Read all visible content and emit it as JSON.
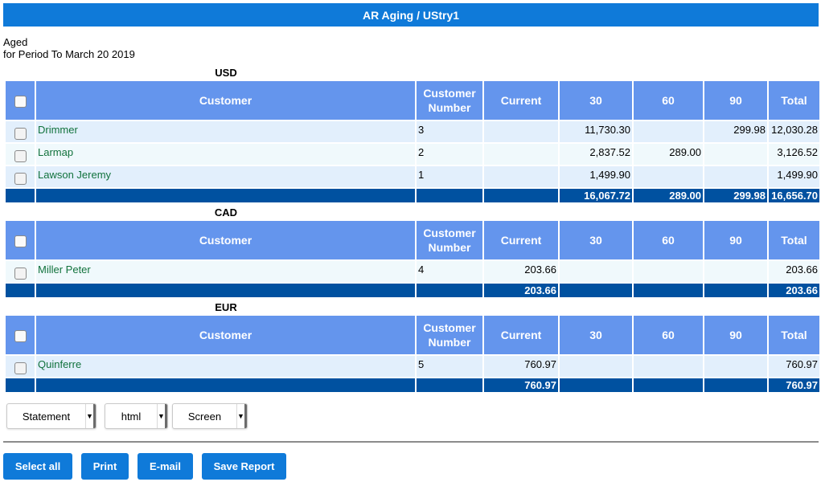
{
  "window": {
    "title": "AR Aging / UStry1"
  },
  "report": {
    "type_label": "Aged",
    "period_label": "for Period To March 20 2019"
  },
  "columns": {
    "customer": "Customer",
    "customer_number": "Customer Number",
    "current": "Current",
    "d30": "30",
    "d60": "60",
    "d90": "90",
    "total": "Total"
  },
  "sections": [
    {
      "currency": "USD",
      "rows": [
        {
          "customer": "Drimmer",
          "number": "3",
          "current": "",
          "d30": "11,730.30",
          "d60": "",
          "d90": "299.98",
          "total": "12,030.28"
        },
        {
          "customer": "Larmap",
          "number": "2",
          "current": "",
          "d30": "2,837.52",
          "d60": "289.00",
          "d90": "",
          "total": "3,126.52"
        },
        {
          "customer": "Lawson Jeremy",
          "number": "1",
          "current": "",
          "d30": "1,499.90",
          "d60": "",
          "d90": "",
          "total": "1,499.90"
        }
      ],
      "totals": {
        "current": "",
        "d30": "16,067.72",
        "d60": "289.00",
        "d90": "299.98",
        "total": "16,656.70"
      }
    },
    {
      "currency": "CAD",
      "rows": [
        {
          "customer": "Miller Peter",
          "number": "4",
          "current": "203.66",
          "d30": "",
          "d60": "",
          "d90": "",
          "total": "203.66"
        }
      ],
      "totals": {
        "current": "203.66",
        "d30": "",
        "d60": "",
        "d90": "",
        "total": "203.66"
      }
    },
    {
      "currency": "EUR",
      "rows": [
        {
          "customer": "Quinferre",
          "number": "5",
          "current": "760.97",
          "d30": "",
          "d60": "",
          "d90": "",
          "total": "760.97"
        }
      ],
      "totals": {
        "current": "760.97",
        "d30": "",
        "d60": "",
        "d90": "",
        "total": "760.97"
      }
    }
  ],
  "controls": {
    "print_type": "Statement",
    "format": "html",
    "media": "Screen"
  },
  "buttons": {
    "select_all": "Select all",
    "print": "Print",
    "email": "E-mail",
    "save_report": "Save Report"
  },
  "colors": {
    "title_bar": "#0f7ad9",
    "header_cell": "#6495ed",
    "totals_row": "#0051a0",
    "customer_link": "#11723c",
    "button": "#0f7ad9"
  },
  "icons": {
    "checkbox": "checkbox-icon",
    "dropdown": "dropdown-arrow-icon"
  }
}
